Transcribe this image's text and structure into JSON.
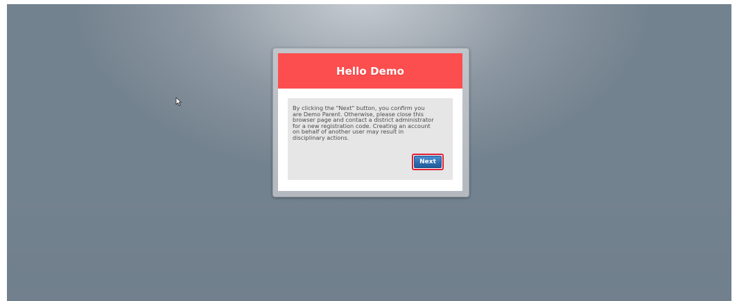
{
  "dialog": {
    "title": "Hello Demo",
    "message": "By clicking the \"Next\" button, you confirm you\nare Demo Parent. Otherwise, please close this\nbrowser page and contact a district administrator\nfor a new registration code. Creating an account\non behalf of another user may result in\ndisciplinary actions.",
    "next_label": "Next"
  },
  "colors": {
    "header": "#fc4e4e",
    "button": "#2e6db0",
    "button_focus_outline": "#e01d33",
    "background": "#72818e"
  },
  "icons": {
    "cursor": "mouse-pointer-icon"
  }
}
